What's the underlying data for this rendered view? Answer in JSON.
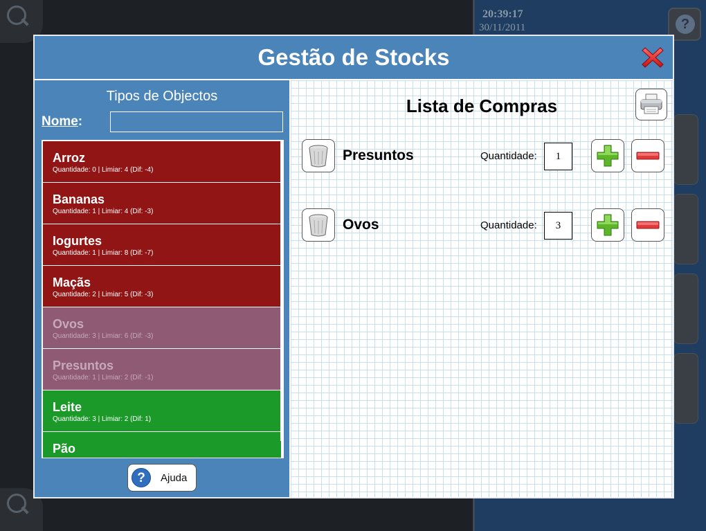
{
  "background": {
    "clock_time": "20:39:17",
    "clock_date": "30/11/2011"
  },
  "dialog": {
    "title": "Gestão de Stocks"
  },
  "object_types": {
    "heading": "Tipos de Objectos",
    "name_label": "Nome",
    "name_colon": ":",
    "name_value": "",
    "items": [
      {
        "name": "Arroz",
        "detail": "Quantidade: 0 | Limiar: 4 (Dif: -4)",
        "status": "red"
      },
      {
        "name": "Bananas",
        "detail": "Quantidade: 1 | Limiar: 4 (Dif: -3)",
        "status": "red"
      },
      {
        "name": "Iogurtes",
        "detail": "Quantidade: 1 | Limiar: 8 (Dif: -7)",
        "status": "red"
      },
      {
        "name": "Maçãs",
        "detail": "Quantidade: 2 | Limiar: 5 (Dif: -3)",
        "status": "red"
      },
      {
        "name": "Ovos",
        "detail": "Quantidade: 3 | Limiar: 6 (Dif: -3)",
        "status": "mauve"
      },
      {
        "name": "Presuntos",
        "detail": "Quantidade: 1 | Limiar: 2 (Dif: -1)",
        "status": "mauve"
      },
      {
        "name": "Leite",
        "detail": "Quantidade: 3 | Limiar: 2 (Dif: 1)",
        "status": "green"
      },
      {
        "name": "Pão",
        "detail": "",
        "status": "green"
      }
    ],
    "help_label": "Ajuda"
  },
  "shopping_list": {
    "title": "Lista de Compras",
    "quantity_label": "Quantidade:",
    "items": [
      {
        "name": "Presuntos",
        "quantity": "1"
      },
      {
        "name": "Ovos",
        "quantity": "3"
      }
    ]
  },
  "icons": {
    "close": "close-x-icon",
    "print": "printer-icon",
    "trash": "trash-icon",
    "plus": "plus-icon",
    "minus": "minus-icon",
    "help": "help-icon"
  },
  "colors": {
    "header_blue": "#4a84b8",
    "item_red": "#921515",
    "item_mauve": "#8e5a74",
    "item_green": "#1b9a2a"
  }
}
